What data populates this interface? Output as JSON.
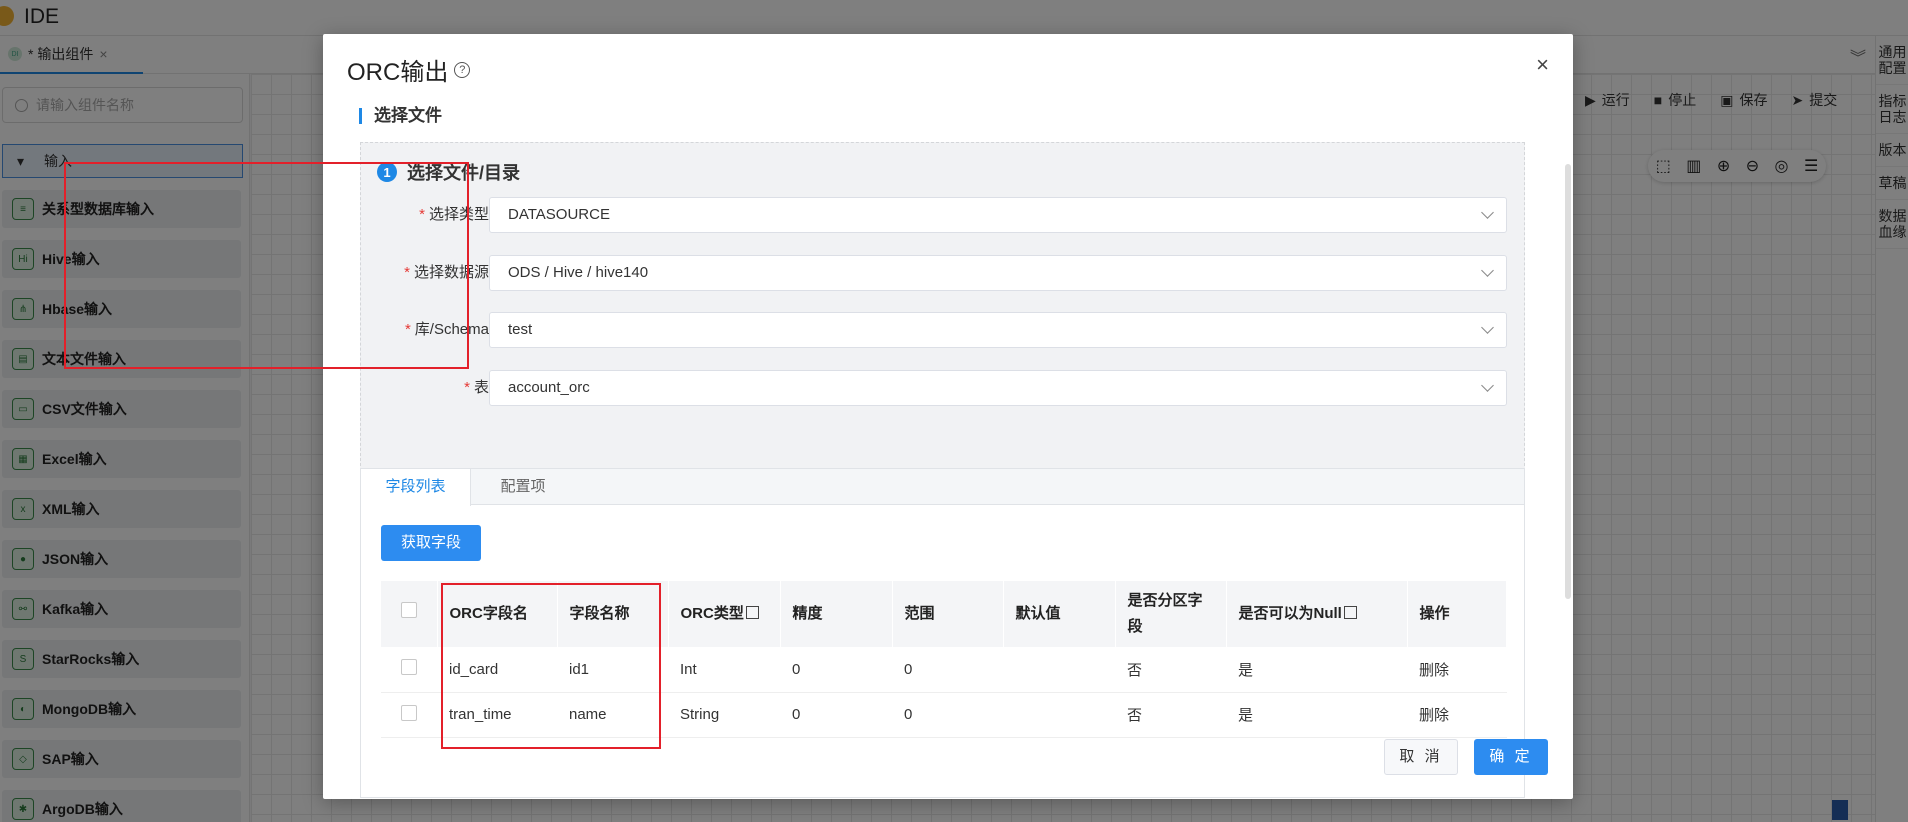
{
  "app": {
    "title": "IDE"
  },
  "tab": {
    "label": "* 输出组件",
    "dot": "DI",
    "close": "×"
  },
  "sidebar": {
    "search_placeholder": "请输入组件名称",
    "group_label": "输入",
    "items": [
      {
        "label": "关系型数据库输入",
        "icon": "database-icon"
      },
      {
        "label": "Hive输入",
        "icon": "hive-icon"
      },
      {
        "label": "Hbase输入",
        "icon": "hbase-icon"
      },
      {
        "label": "文本文件输入",
        "icon": "text-file-icon"
      },
      {
        "label": "CSV文件输入",
        "icon": "csv-icon"
      },
      {
        "label": "Excel输入",
        "icon": "excel-icon"
      },
      {
        "label": "XML输入",
        "icon": "xml-icon"
      },
      {
        "label": "JSON输入",
        "icon": "json-icon"
      },
      {
        "label": "Kafka输入",
        "icon": "kafka-icon"
      },
      {
        "label": "StarRocks输入",
        "icon": "starrocks-icon"
      },
      {
        "label": "MongoDB输入",
        "icon": "mongodb-icon"
      },
      {
        "label": "SAP输入",
        "icon": "sap-icon"
      },
      {
        "label": "ArgoDB输入",
        "icon": "argodb-icon"
      }
    ]
  },
  "toolbar": {
    "run": "运行",
    "stop": "停止",
    "save": "保存",
    "submit": "提交"
  },
  "rightbar": [
    "通用配置",
    "指标日志",
    "版本",
    "草稿",
    "数据血缘"
  ],
  "modal": {
    "title": "ORC输出",
    "section": "选择文件",
    "step_number": "1",
    "step_title": "选择文件/目录",
    "fields": [
      {
        "label": "选择类型",
        "value": "DATASOURCE"
      },
      {
        "label": "选择数据源",
        "value": "ODS / Hive / hive140"
      },
      {
        "label": "库/Schema",
        "value": "test"
      },
      {
        "label": "表",
        "value": "account_orc"
      }
    ],
    "tabs": [
      "字段列表",
      "配置项"
    ],
    "fetch_button": "获取字段",
    "table": {
      "headers": [
        "ORC字段名",
        "字段名称",
        "ORC类型",
        "精度",
        "范围",
        "默认值",
        "是否分区字段",
        "是否可以为Null",
        "操作"
      ],
      "rows": [
        [
          "id_card",
          "id1",
          "Int",
          "0",
          "0",
          "",
          "否",
          "是",
          "删除"
        ],
        [
          "tran_time",
          "name",
          "String",
          "0",
          "0",
          "",
          "否",
          "是",
          "删除"
        ]
      ]
    },
    "cancel": "取 消",
    "ok": "确 定"
  }
}
